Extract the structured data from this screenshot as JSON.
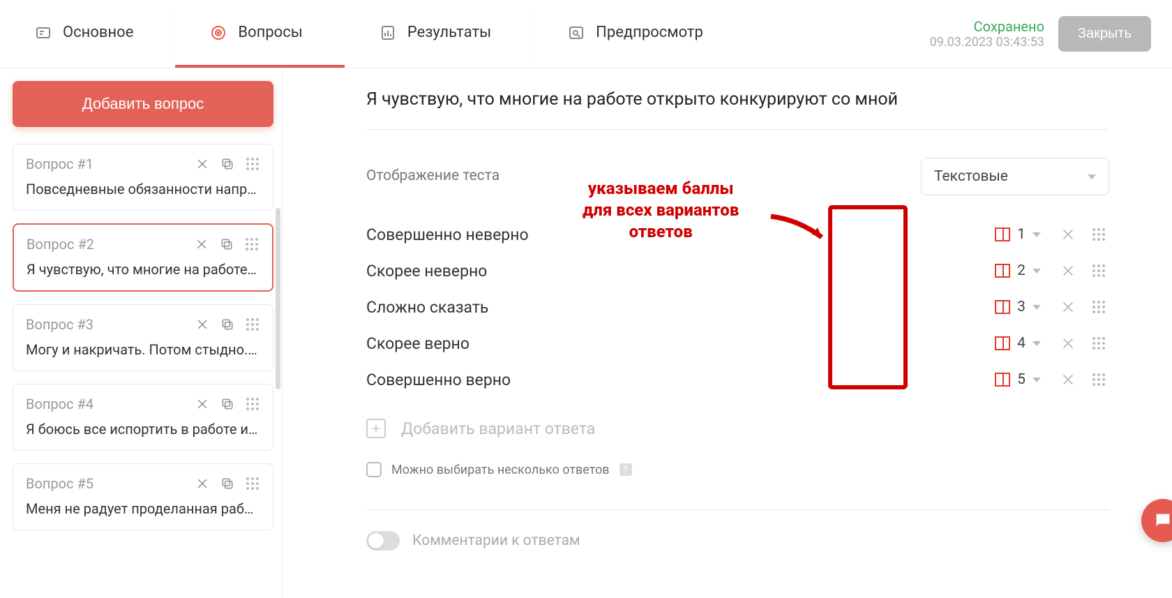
{
  "header": {
    "tabs": [
      {
        "label": "Основное"
      },
      {
        "label": "Вопросы"
      },
      {
        "label": "Результаты"
      },
      {
        "label": "Предпросмотр"
      }
    ],
    "saved_label": "Сохранено",
    "saved_ts": "09.03.2023 03:43:53",
    "close_label": "Закрыть"
  },
  "sidebar": {
    "add_label": "Добавить вопрос",
    "questions": [
      {
        "title": "Вопрос #1",
        "text": "Повседневные обязанности напряга…"
      },
      {
        "title": "Вопрос #2",
        "text": "Я чувствую, что многие на работе от…"
      },
      {
        "title": "Вопрос #3",
        "text": "Могу и накричать. Потом стыдно. Ран…"
      },
      {
        "title": "Вопрос #4",
        "text": "Я боюсь все испортить в работе и вс…"
      },
      {
        "title": "Вопрос #5",
        "text": "Меня не радует проделанная работа"
      }
    ]
  },
  "main": {
    "question_text": "Я чувствую, что многие на работе открыто конкурируют со мной",
    "display_label": "Отображение теста",
    "display_value": "Текстовые",
    "annotation_line1": "указываем баллы",
    "annotation_line2": "для всех вариантов",
    "annotation_line3": "ответов",
    "answers": [
      {
        "label": "Совершенно неверно",
        "score": "1"
      },
      {
        "label": "Скорее неверно",
        "score": "2"
      },
      {
        "label": "Сложно сказать",
        "score": "3"
      },
      {
        "label": "Скорее верно",
        "score": "4"
      },
      {
        "label": "Совершенно верно",
        "score": "5"
      }
    ],
    "add_answer_label": "Добавить вариант ответа",
    "multi_label": "Можно выбирать несколько ответов",
    "comments_label": "Комментарии к ответам"
  }
}
